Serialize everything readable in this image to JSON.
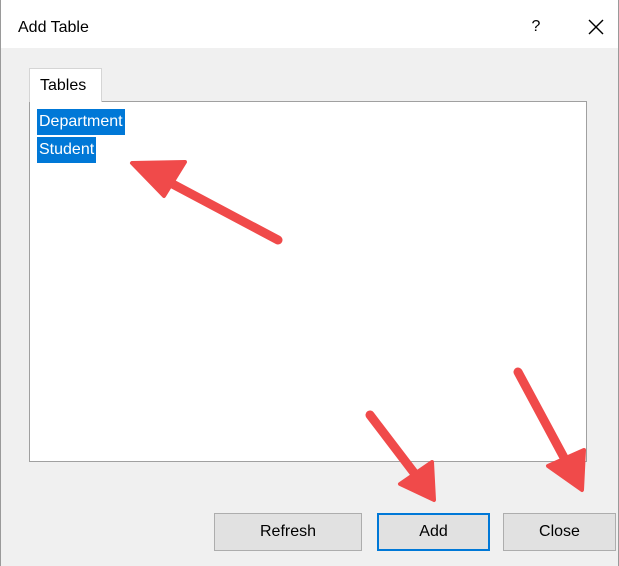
{
  "window": {
    "title": "Add Table",
    "help_label": "?"
  },
  "tabs": [
    {
      "label": "Tables"
    }
  ],
  "tables_list": [
    {
      "label": "Department"
    },
    {
      "label": "Student"
    }
  ],
  "buttons": {
    "refresh": "Refresh",
    "add": "Add",
    "close": "Close"
  },
  "colors": {
    "selection": "#0078d7",
    "annotation_arrow": "#f04a4a"
  }
}
